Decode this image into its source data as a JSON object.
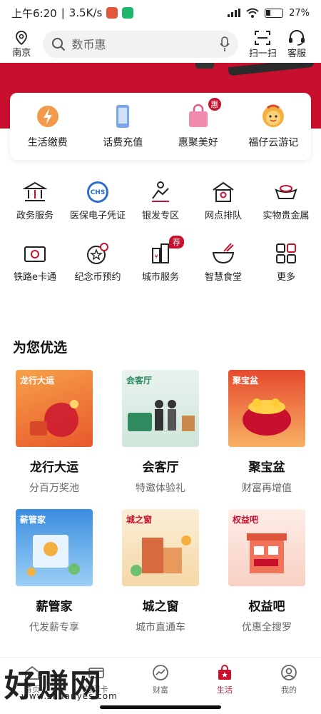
{
  "status_bar": {
    "time": "上午6:20",
    "speed": "3.5K/s",
    "battery": "27%"
  },
  "header": {
    "location": "南京",
    "search_placeholder": "数币惠",
    "scan_label": "扫一扫",
    "service_label": "客服"
  },
  "quick_actions": [
    {
      "label": "生活缴费",
      "icon": "lightning-icon"
    },
    {
      "label": "话费充值",
      "icon": "phone-icon"
    },
    {
      "label": "惠聚美好",
      "icon": "shopping-bag-icon",
      "badge": "惠"
    },
    {
      "label": "福仔云游记",
      "icon": "mascot-icon"
    }
  ],
  "services": [
    {
      "label": "政务服务",
      "icon": "government-icon"
    },
    {
      "label": "医保电子凭证",
      "icon": "chs-icon"
    },
    {
      "label": "银发专区",
      "icon": "elderly-icon"
    },
    {
      "label": "网点排队",
      "icon": "branch-queue-icon"
    },
    {
      "label": "实物贵金属",
      "icon": "gold-ingot-icon"
    },
    {
      "label": "铁路e卡通",
      "icon": "railway-card-icon"
    },
    {
      "label": "纪念币预约",
      "icon": "coin-clock-icon"
    },
    {
      "label": "城市服务",
      "icon": "city-building-icon",
      "badge": "荐"
    },
    {
      "label": "智慧食堂",
      "icon": "noodle-bowl-icon"
    },
    {
      "label": "更多",
      "icon": "more-grid-icon"
    }
  ],
  "section_title": "为您优选",
  "cards": [
    {
      "thumb_title": "龙行大运",
      "name": "龙行大运",
      "sub": "分百万奖池",
      "color": "#e8582a"
    },
    {
      "thumb_title": "会客厅",
      "name": "会客厅",
      "sub": "特邀体验礼",
      "color": "#2f8a5f"
    },
    {
      "thumb_title": "聚宝盆",
      "name": "聚宝盆",
      "sub": "财富再增值",
      "color": "#d9472b"
    },
    {
      "thumb_title": "薪管家",
      "name": "薪管家",
      "sub": "代发薪专享",
      "color": "#3b8de0"
    },
    {
      "thumb_title": "城之窗",
      "name": "城之窗",
      "sub": "城市直通车",
      "color": "#e6a64a"
    },
    {
      "thumb_title": "权益吧",
      "name": "权益吧",
      "sub": "优惠全搜罗",
      "color": "#e0553b"
    }
  ],
  "bottom_nav": [
    {
      "label": "首页",
      "icon": "home-icon"
    },
    {
      "label": "信用卡",
      "icon": "card-icon"
    },
    {
      "label": "财富",
      "icon": "wealth-chart-icon"
    },
    {
      "label": "生活",
      "icon": "life-bag-icon",
      "active": true
    },
    {
      "label": "我的",
      "icon": "profile-icon"
    }
  ],
  "watermark": {
    "text": "好赚网",
    "url": "www.zhuanyes.com"
  },
  "colors": {
    "brand_red": "#c8102e"
  }
}
